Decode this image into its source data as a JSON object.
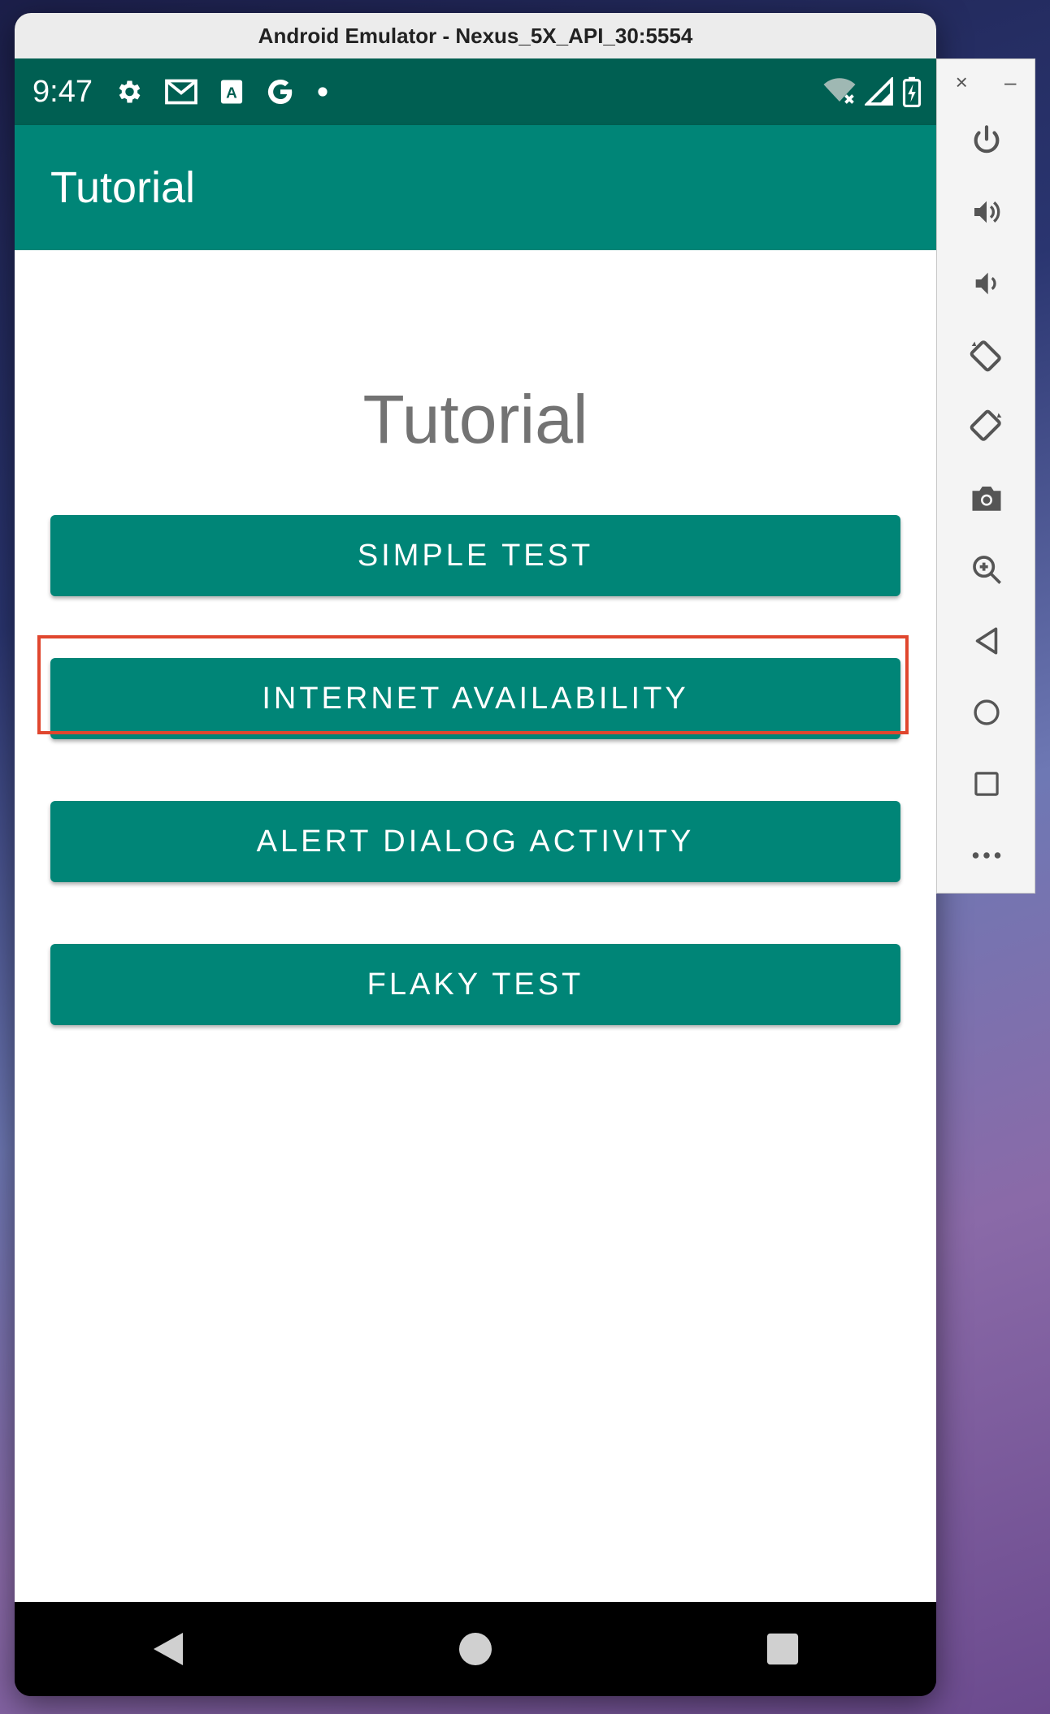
{
  "window": {
    "title": "Android Emulator - Nexus_5X_API_30:5554"
  },
  "status_bar": {
    "time": "9:47",
    "icons": [
      "gear-icon",
      "gmail-icon",
      "a-icon",
      "google-icon",
      "dot-icon"
    ],
    "right_icons": [
      "wifi-off-icon",
      "signal-icon",
      "battery-charging-icon"
    ]
  },
  "app_bar": {
    "title": "Tutorial"
  },
  "main": {
    "heading": "Tutorial",
    "buttons": [
      {
        "label": "SIMPLE TEST"
      },
      {
        "label": "INTERNET AVAILABILITY",
        "highlighted": true
      },
      {
        "label": "ALERT DIALOG ACTIVITY"
      },
      {
        "label": "FLAKY TEST"
      }
    ]
  },
  "nav_bar": {
    "items": [
      "back-icon",
      "home-icon",
      "recents-icon"
    ]
  },
  "toolbar": {
    "window_controls": {
      "close": "×",
      "minimize": "–"
    },
    "items": [
      "power-icon",
      "volume-up-icon",
      "volume-down-icon",
      "rotate-left-icon",
      "rotate-right-icon",
      "camera-icon",
      "zoom-icon",
      "back-icon",
      "home-icon",
      "overview-icon",
      "more-icon"
    ]
  },
  "colors": {
    "primary": "#008577",
    "primary_dark": "#005f52",
    "highlight": "#e0462e"
  }
}
